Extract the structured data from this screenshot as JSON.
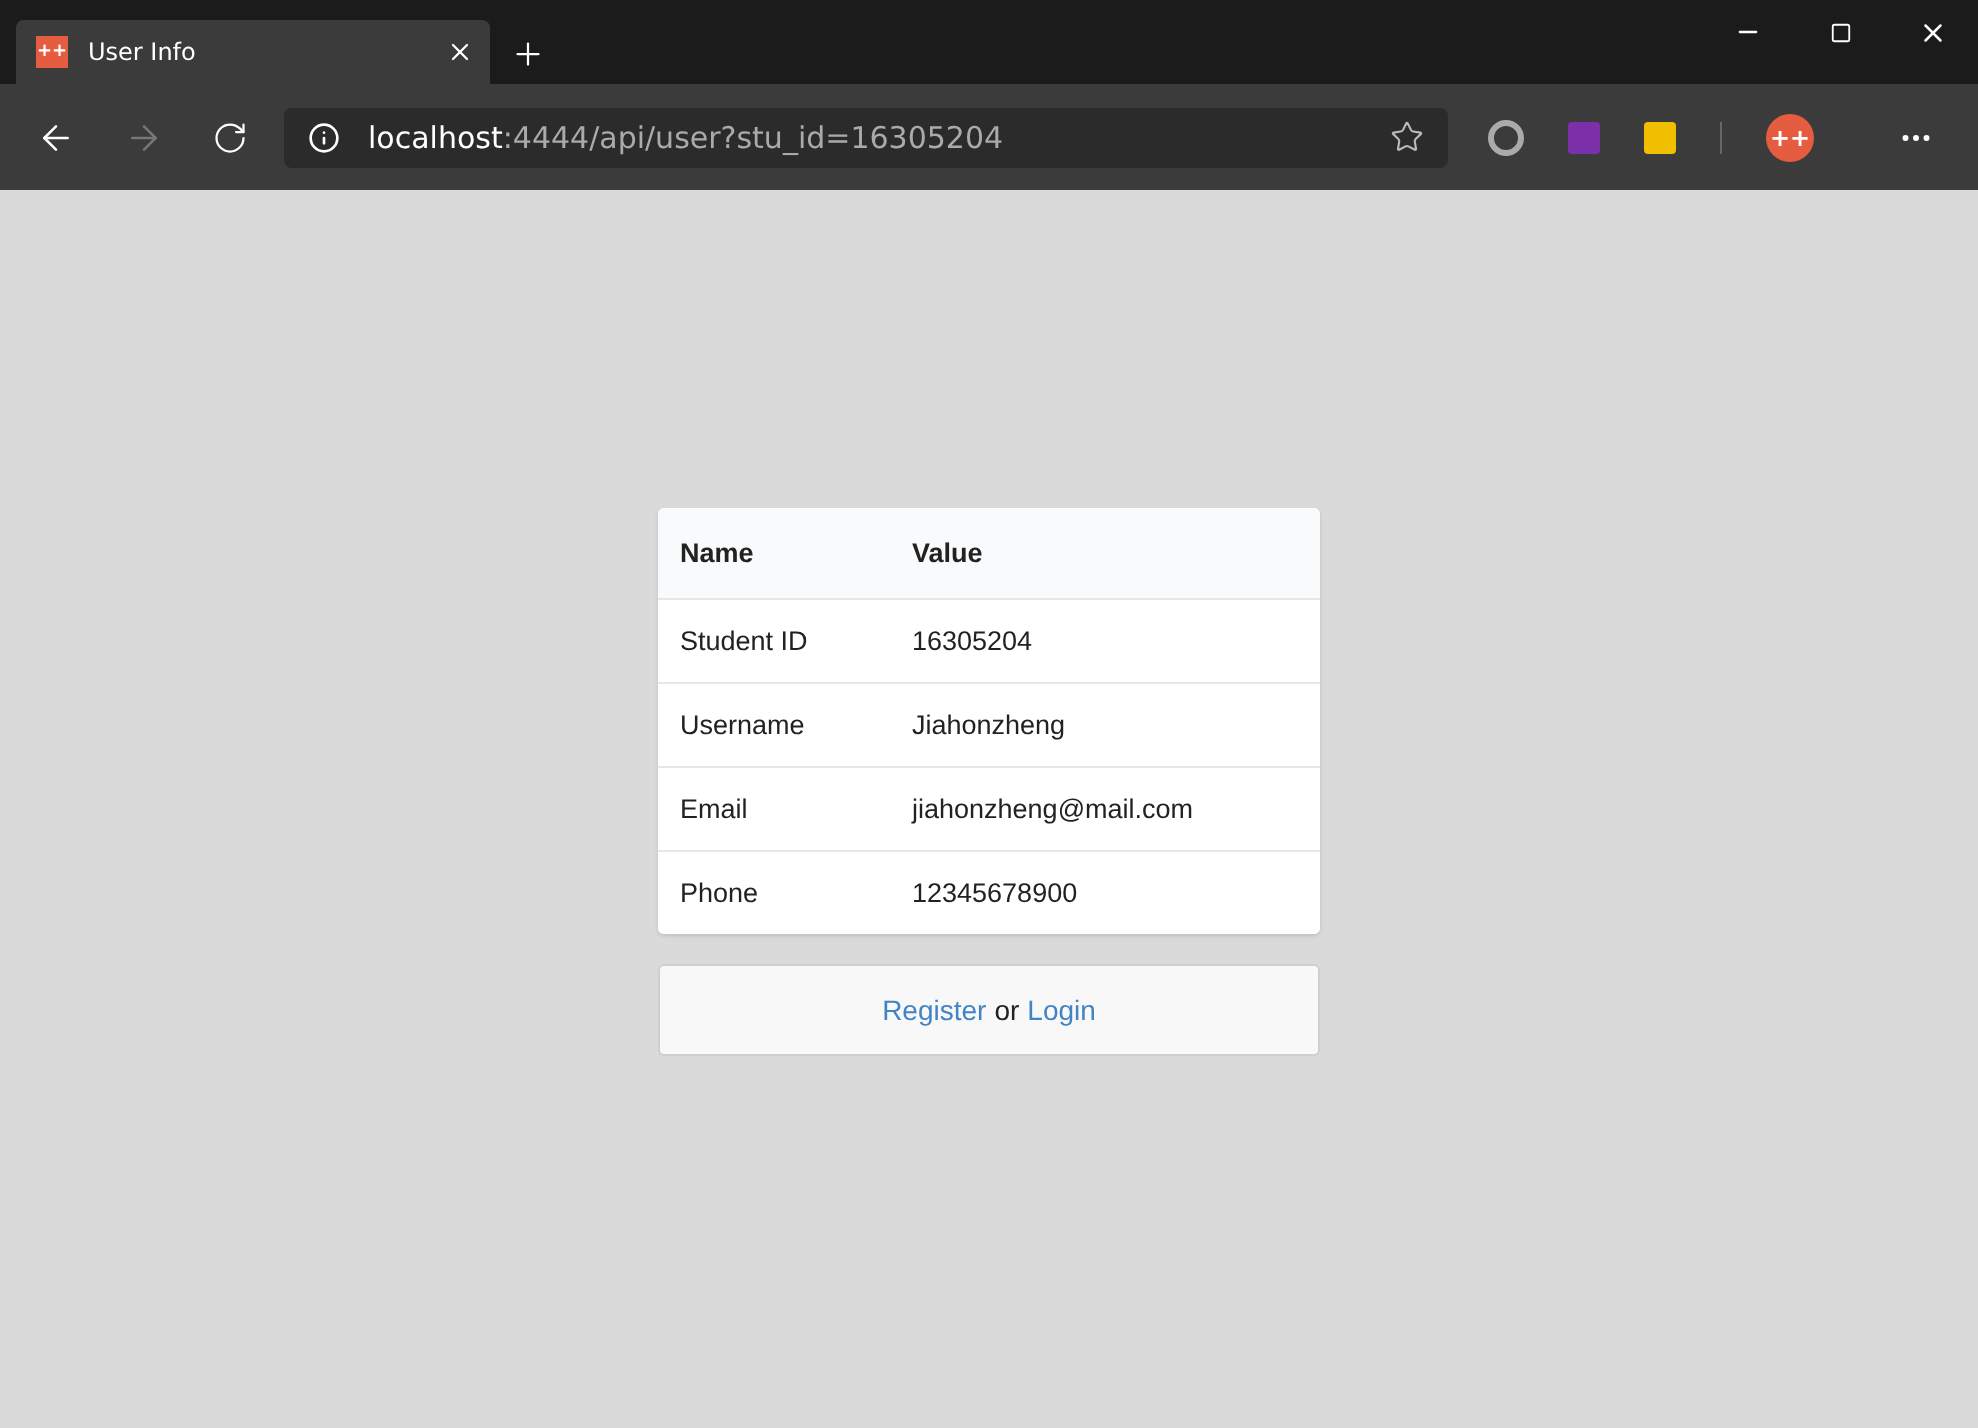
{
  "tab": {
    "favicon": "++",
    "title": "User Info",
    "selected": true
  },
  "address": {
    "host": "localhost",
    "path": ":4444/api/user?stu_id=16305204"
  },
  "profile": {
    "initials": "++"
  },
  "table": {
    "columns": [
      "Name",
      "Value"
    ],
    "rows": [
      [
        "Student ID",
        "16305204"
      ],
      [
        "Username",
        "Jiahonzheng"
      ],
      [
        "Email",
        "jiahonzheng@mail.com"
      ],
      [
        "Phone",
        "12345678900"
      ]
    ]
  },
  "auth": {
    "register": "Register",
    "separator": "or",
    "login": "Login"
  }
}
